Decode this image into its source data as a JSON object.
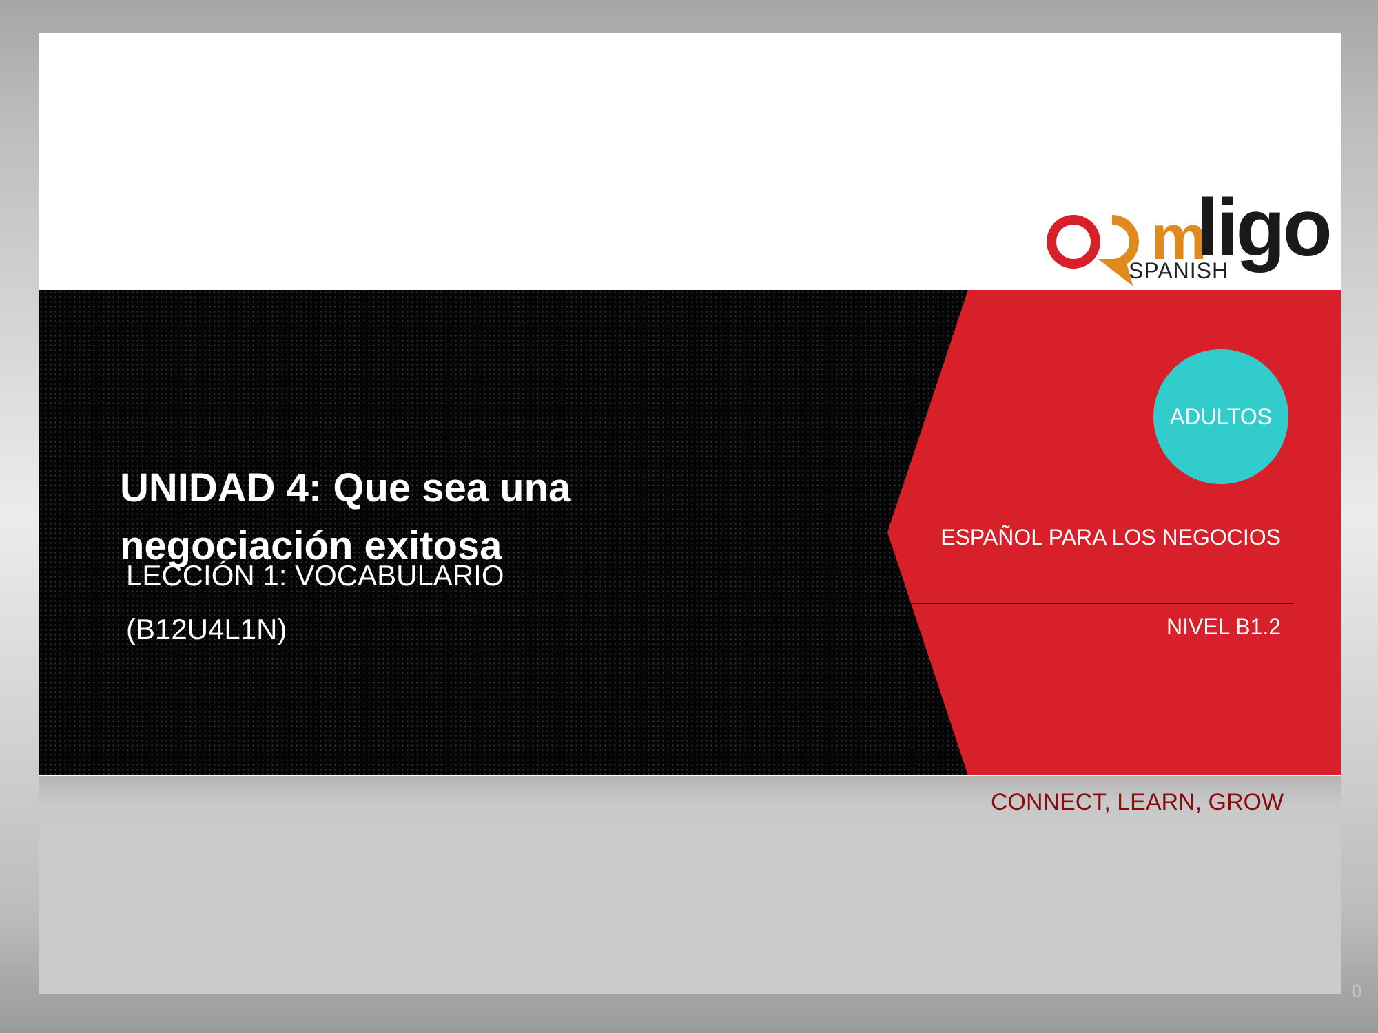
{
  "logo": {
    "wordmark": "comligo",
    "part_m": "m",
    "part_ligo": "ligo",
    "subtitle": "SPANISH",
    "colors": {
      "red": "#d8202a",
      "orange": "#e08a1e",
      "dark": "#1a1a1a"
    }
  },
  "title_line1": "UNIDAD 4: Que sea una",
  "title_line2": "negociación exitosa",
  "lesson": "LECCIÓN 1: VOCABULARIO",
  "code": "(B12U4L1N)",
  "badge": "ADULTOS",
  "course": "ESPAÑOL PARA LOS NEGOCIOS",
  "level": "NIVEL B1.2",
  "tagline": "CONNECT, LEARN, GROW",
  "page_number": "0",
  "colors": {
    "red_panel": "#d8202a",
    "badge": "#33cccc",
    "tagline": "#8b0b0b",
    "band": "#050505"
  }
}
